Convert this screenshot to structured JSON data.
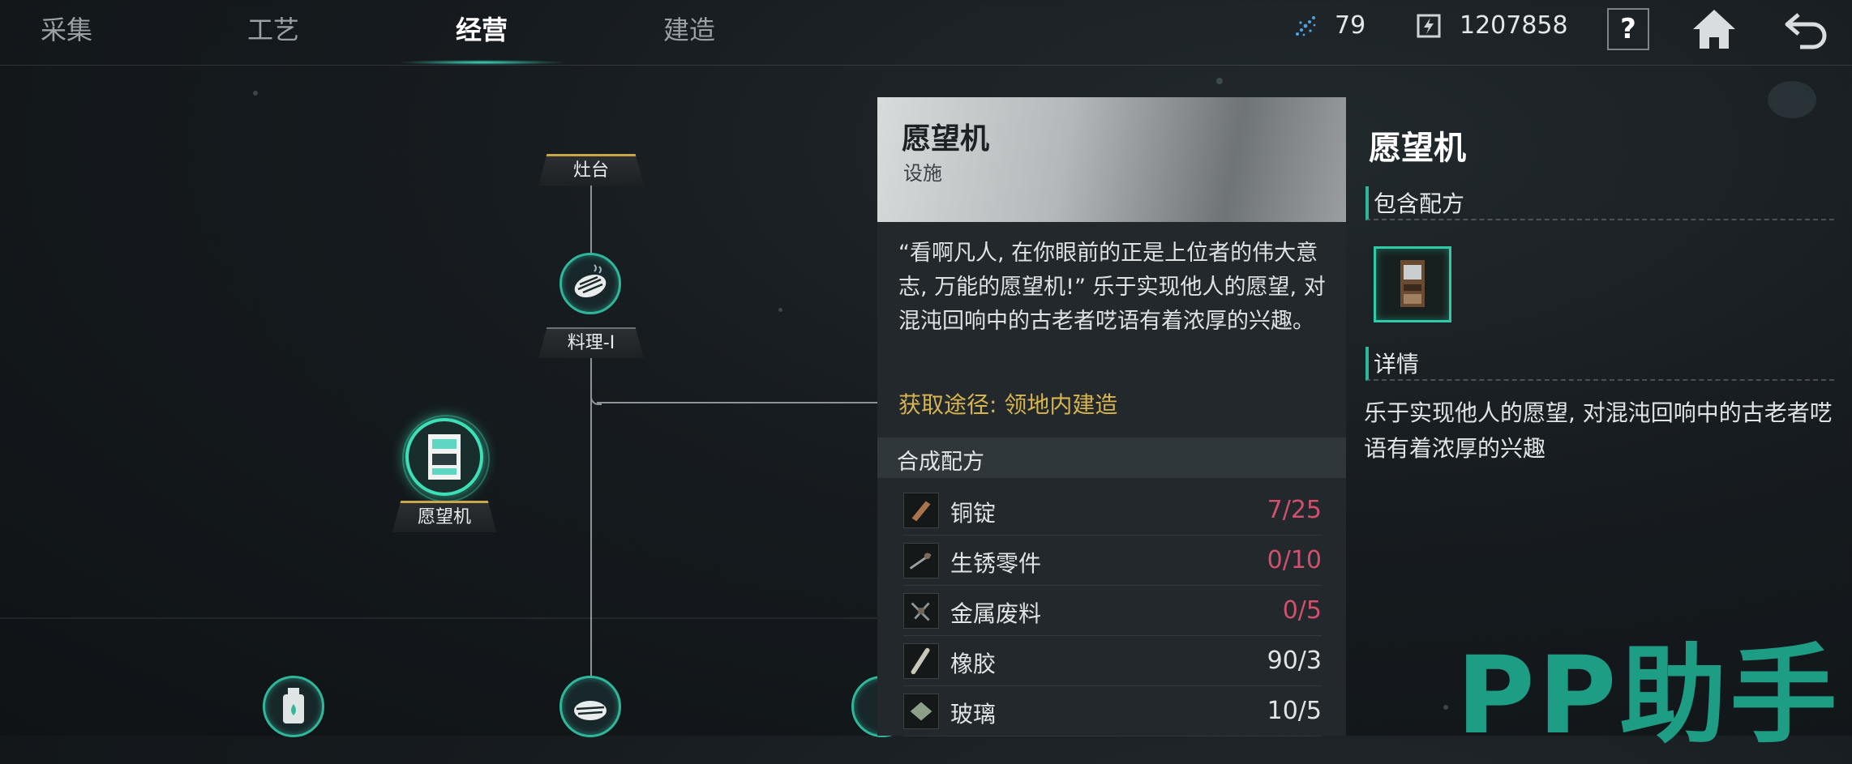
{
  "tabs": [
    {
      "label": "采集",
      "active": false
    },
    {
      "label": "工艺",
      "active": false
    },
    {
      "label": "经营",
      "active": true
    },
    {
      "label": "建造",
      "active": false
    }
  ],
  "resources": {
    "energy": {
      "icon": "crystal-icon",
      "value": "79"
    },
    "currency": {
      "icon": "coin-icon",
      "value": "1207858"
    }
  },
  "buttons": {
    "help_label": "?",
    "home_icon": "home-icon",
    "back_icon": "back-arrow-icon"
  },
  "tree": {
    "stove_label": "灶台",
    "cooking_label": "料理-I",
    "wish_machine_label": "愿望机"
  },
  "detail": {
    "title": "愿望机",
    "subtitle": "设施",
    "description": "“看啊凡人, 在你眼前的正是上位者的伟大意志, 万能的愿望机!” 乐于实现他人的愿望, 对混沌回响中的古老者呓语有着浓厚的兴趣。",
    "source": "获取途径: 领地内建造",
    "recipe_header": "合成配方",
    "ingredients": [
      {
        "name": "铜锭",
        "count": "7/25",
        "short": true,
        "icon": "copper-ingot-icon"
      },
      {
        "name": "生锈零件",
        "count": "0/10",
        "short": true,
        "icon": "rusty-parts-icon"
      },
      {
        "name": "金属废料",
        "count": "0/5",
        "short": true,
        "icon": "scrap-metal-icon"
      },
      {
        "name": "橡胶",
        "count": "90/3",
        "short": false,
        "icon": "rubber-icon"
      },
      {
        "name": "玻璃",
        "count": "10/5",
        "short": false,
        "icon": "glass-icon"
      }
    ]
  },
  "info": {
    "title": "愿望机",
    "recipes_header": "包含配方",
    "details_header": "详情",
    "details_text": "乐于实现他人的愿望, 对混沌回响中的古老者呓语有着浓厚的兴趣"
  },
  "watermark": "PP助手",
  "colors": {
    "accent": "#2fb79c",
    "shortage": "#d0506e",
    "source": "#d8b44e"
  }
}
